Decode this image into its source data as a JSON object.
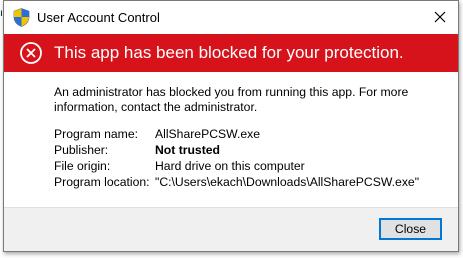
{
  "window": {
    "title": "User Account Control",
    "close_glyph": "✕"
  },
  "banner": {
    "text": "This app has been blocked for your protection.",
    "icon": "error-x-icon",
    "color": "#d6121b"
  },
  "message": {
    "text": "An administrator has blocked you from running this app. For more information, contact the administrator."
  },
  "details": [
    {
      "label": "Program name:",
      "value": "AllSharePCSW.exe",
      "bold": false
    },
    {
      "label": "Publisher:",
      "value": "Not trusted",
      "bold": true
    },
    {
      "label": "File origin:",
      "value": "Hard drive on this computer",
      "bold": false
    },
    {
      "label": "Program location:",
      "value": "\"C:\\Users\\ekach\\Downloads\\AllSharePCSW.exe\"",
      "bold": false
    }
  ],
  "footer": {
    "close_label": "Close",
    "accent": "#0078d7"
  },
  "icons": {
    "title_icon": "uac-shield-icon",
    "close_icon": "close-icon"
  }
}
